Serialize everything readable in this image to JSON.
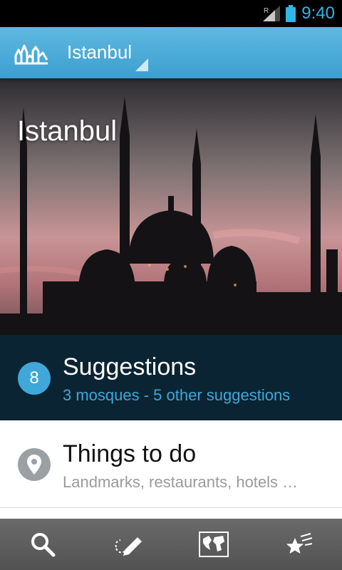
{
  "status_bar": {
    "time": "9:40",
    "roaming_indicator": "R",
    "icons": [
      "signal-icon",
      "battery-icon"
    ]
  },
  "action_bar": {
    "logo_icon": "skyline-logo-icon",
    "city_selector": "Istanbul"
  },
  "hero": {
    "title": "Istanbul"
  },
  "rows": {
    "suggestions": {
      "badge_count": "8",
      "title": "Suggestions",
      "subtitle": "3 mosques - 5 other suggestions"
    },
    "things_to_do": {
      "icon": "map-pin-icon",
      "title": "Things to do",
      "subtitle": "Landmarks, restaurants, hotels …"
    }
  },
  "bottom_tabs": [
    "search-icon",
    "pencil-icon",
    "map-icon",
    "stars-icon"
  ],
  "colors": {
    "accent": "#33b5e5",
    "action_bar": "#4aa8d6",
    "suggestions_bg": "#0b2433",
    "badge": "#3fa8d8"
  }
}
